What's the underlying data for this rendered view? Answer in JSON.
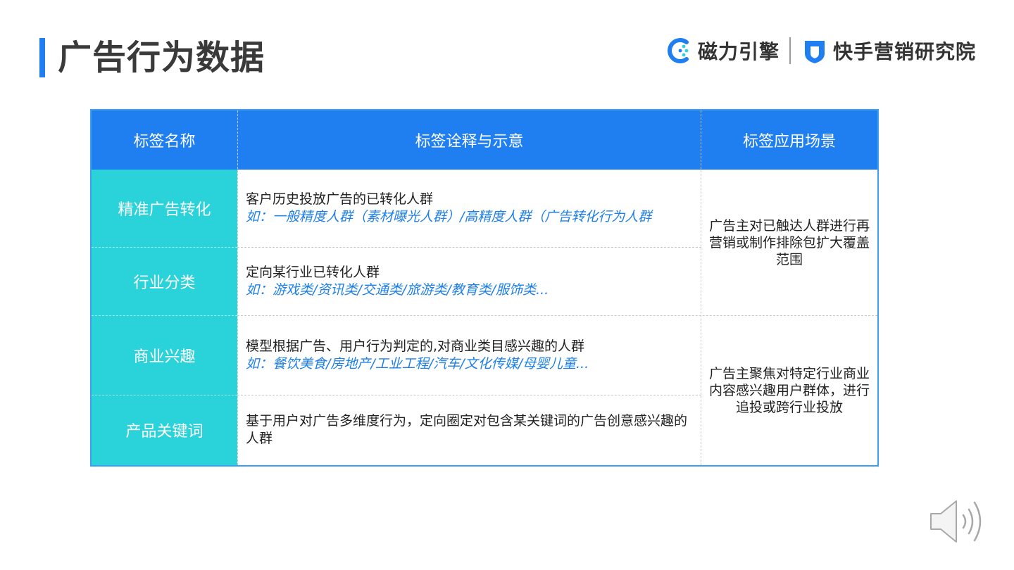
{
  "slide": {
    "title": "广告行为数据",
    "accent_color": "#1f7ef0"
  },
  "logos": {
    "left_logo_icon": "magnet-engine-logo-icon",
    "left_logo_text": "磁力引擎",
    "right_logo_icon": "kuaishou-shield-logo-icon",
    "right_logo_text": "快手营销研究院"
  },
  "table": {
    "headers": [
      "标签名称",
      "标签诠释与示意",
      "标签应用场景"
    ],
    "header_color": "#1f7ef0",
    "label_color": "#2ad3d9",
    "example_color": "#1e7fe8",
    "rows": [
      {
        "label": "精准广告转化",
        "desc": "客户历史投放广告的已转化人群",
        "example": "如：一般精度人群（素材曝光人群）/高精度人群（广告转化行为人群"
      },
      {
        "label": "行业分类",
        "desc": "定向某行业已转化人群",
        "example": "如：游戏类/资讯类/交通类/旅游类/教育类/服饰类..."
      },
      {
        "label": "商业兴趣",
        "desc": "模型根据广告、用户行为判定的,对商业类目感兴趣的人群",
        "example": "如：餐饮美食/房地产/工业工程/汽车/文化传媒/母婴儿童..."
      },
      {
        "label": "产品关键词",
        "desc": "基于用户对广告多维度行为，定向圈定对包含某关键词的广告创意感兴趣的人群",
        "example": ""
      }
    ],
    "scenes": [
      "广告主对已触达人群进行再营销或制作排除包扩大覆盖范围",
      "广告主聚焦对特定行业商业内容感兴趣用户群体，进行追投或跨行业投放"
    ]
  },
  "controls": {
    "audio_icon": "speaker-icon"
  }
}
